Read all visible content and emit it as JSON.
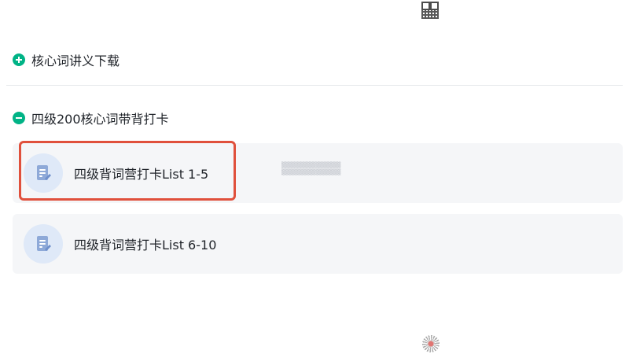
{
  "sections": [
    {
      "title": "核心词讲义下载",
      "state": "collapsed",
      "toggle_icon": "plus-circle-icon"
    },
    {
      "title": "四级200核心词带背打卡",
      "state": "expanded",
      "toggle_icon": "minus-circle-icon",
      "items": [
        {
          "label": "四级背词营打卡List 1-5",
          "icon": "document-edit-icon",
          "highlighted": true
        },
        {
          "label": "四级背词营打卡List 6-10",
          "icon": "document-edit-icon",
          "highlighted": false
        }
      ]
    }
  ],
  "colors": {
    "accent": "#00b386",
    "highlight_border": "#e0503c",
    "card_bg": "#f5f6f8",
    "icon_bg": "#dfe9f8",
    "icon_fg": "#8ea9d8"
  }
}
